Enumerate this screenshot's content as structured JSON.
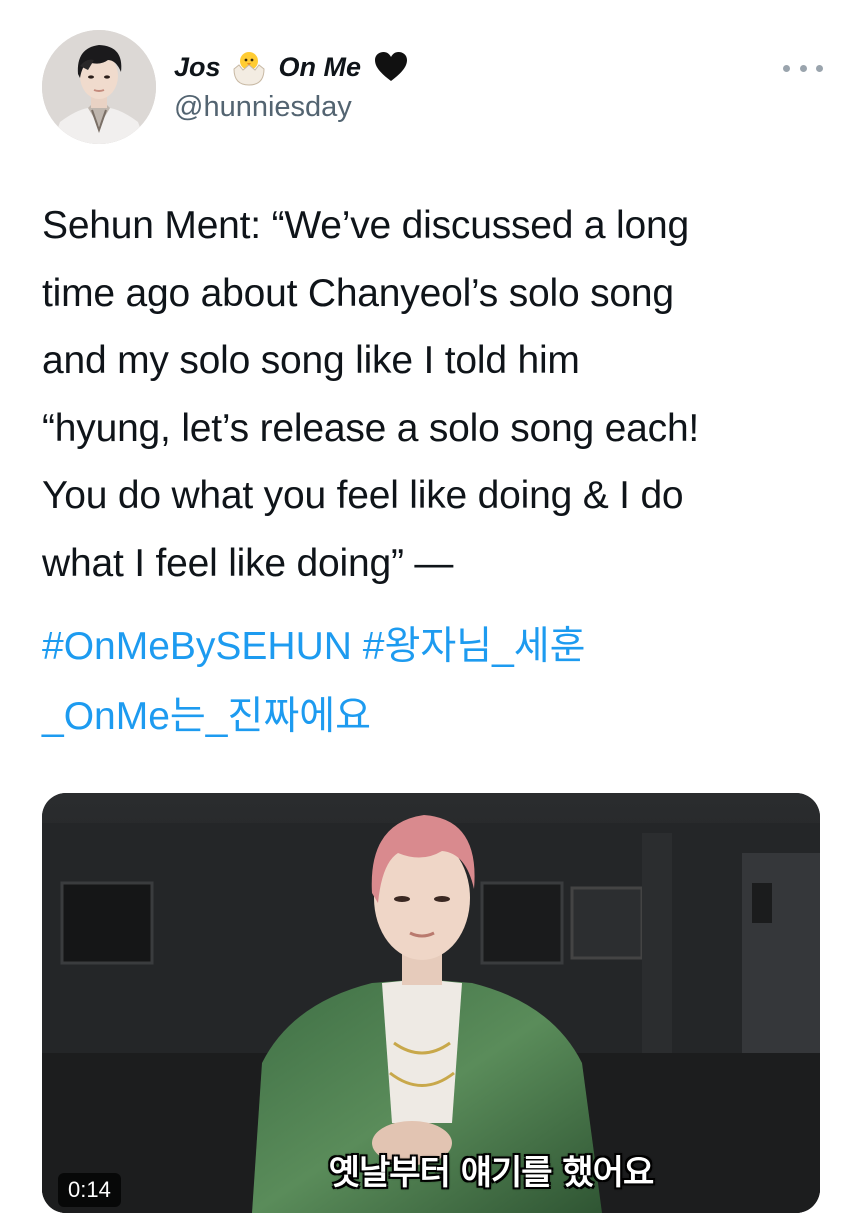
{
  "user": {
    "display_name_part1": "Jos",
    "display_name_part2": "On Me",
    "name_emojis": [
      "hatching-chick-icon",
      "black-heart-icon"
    ],
    "handle": "@hunniesday"
  },
  "tweet": {
    "text_lines": [
      "Sehun Ment: “We’ve discussed a long",
      "time ago about Chanyeol’s solo song",
      "and my solo song like I told him",
      "“hyung, let’s release a solo song each!",
      "You do what you feel like doing & I do",
      "what I feel like doing” —"
    ],
    "hashtags": [
      "#OnMeBySEHUN",
      "#왕자님_세훈",
      "_OnMe는_진짜에요"
    ]
  },
  "media": {
    "type": "video",
    "subtitle": "옛날부터 얘기를 했어요",
    "duration": "0:14"
  },
  "colors": {
    "text": "#0f1419",
    "secondary": "#536471",
    "link": "#1d9bf0",
    "background": "#ffffff"
  }
}
